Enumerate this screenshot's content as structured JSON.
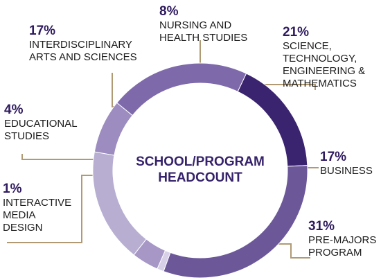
{
  "chart_data": {
    "type": "pie",
    "title": "",
    "center_label": [
      "SCHOOL/PROGRAM",
      "HEADCOUNT"
    ],
    "slices": [
      {
        "pct_label": "8%",
        "value": 8,
        "lines": [
          "NURSING AND",
          "HEALTH STUDIES"
        ],
        "color": "#9c8cbf"
      },
      {
        "pct_label": "21%",
        "value": 21,
        "lines": [
          "SCIENCE,",
          "TECHNOLOGY,",
          "ENGINEERING &",
          "MATHEMATICS"
        ],
        "color": "#7e6aab"
      },
      {
        "pct_label": "17%",
        "value": 17,
        "lines": [
          "BUSINESS"
        ],
        "color": "#3a246f"
      },
      {
        "pct_label": "31%",
        "value": 31,
        "lines": [
          "PRE-MAJORS",
          "PROGRAM"
        ],
        "color": "#6c5899"
      },
      {
        "pct_label": "1%",
        "value": 1,
        "lines": [
          "INTERACTIVE",
          "MEDIA",
          "DESIGN"
        ],
        "color": "#d7d0e6"
      },
      {
        "pct_label": "4%",
        "value": 4,
        "lines": [
          "EDUCATIONAL",
          "STUDIES"
        ],
        "color": "#a697c6"
      },
      {
        "pct_label": "17%",
        "value": 17,
        "lines": [
          "INTERDISCIPLINARY",
          "ARTS AND SCIENCES"
        ],
        "color": "#b7aed2"
      }
    ],
    "leader_color": "#b09a74"
  }
}
